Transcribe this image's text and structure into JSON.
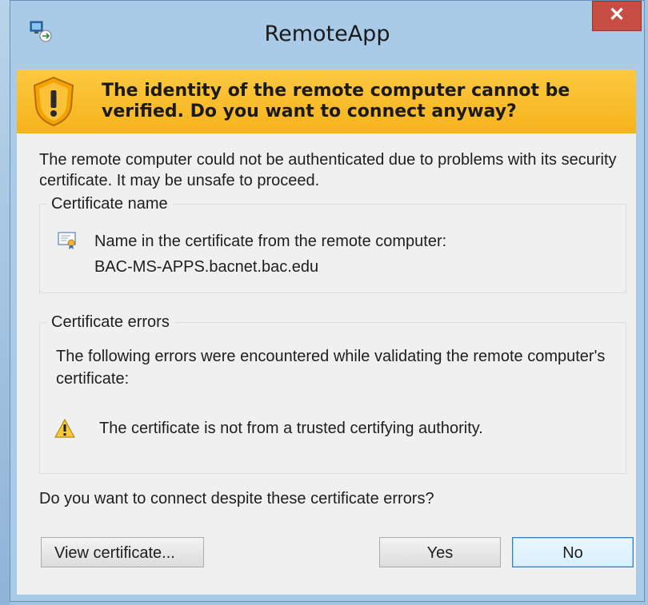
{
  "window": {
    "title": "RemoteApp",
    "close_glyph": "✕",
    "app_icon": "remote-desktop-icon"
  },
  "banner": {
    "icon": "warning-shield-icon",
    "text": "The identity of the remote computer cannot be verified. Do you want to connect anyway?"
  },
  "body": {
    "description": "The remote computer could not be authenticated due to problems with its security certificate. It may be unsafe to proceed."
  },
  "certificate_name": {
    "label": "Certificate name",
    "icon": "certificate-icon",
    "line1": "Name in the certificate from the remote computer:",
    "line2": "BAC-MS-APPS.bacnet.bac.edu"
  },
  "certificate_errors": {
    "label": "Certificate errors",
    "description": "The following errors were encountered while validating the remote computer's certificate:",
    "items": [
      {
        "icon": "warning-icon",
        "text": "The certificate is not from a trusted certifying authority."
      }
    ]
  },
  "question": "Do you want to connect despite these certificate errors?",
  "buttons": {
    "view": "View certificate...",
    "yes": "Yes",
    "no": "No"
  },
  "colors": {
    "banner": "#f8bd2e",
    "title_bar": "#aacbe8",
    "close_button": "#c74e43"
  }
}
